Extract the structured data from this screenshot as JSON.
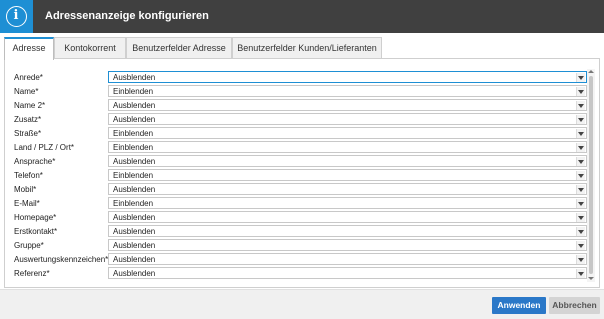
{
  "window": {
    "title": "Adressenanzeige konfigurieren",
    "icon": "info-icon"
  },
  "tabs": [
    {
      "label": "Adresse",
      "active": true
    },
    {
      "label": "Kontokorrent",
      "active": false
    },
    {
      "label": "Benutzerfelder Adresse",
      "active": false
    },
    {
      "label": "Benutzerfelder Kunden/Lieferanten",
      "active": false
    }
  ],
  "fields": [
    {
      "label": "Anrede*",
      "value": "Ausblenden"
    },
    {
      "label": "Name*",
      "value": "Einblenden"
    },
    {
      "label": "Name 2*",
      "value": "Ausblenden"
    },
    {
      "label": "Zusatz*",
      "value": "Ausblenden"
    },
    {
      "label": "Straße*",
      "value": "Einblenden"
    },
    {
      "label": "Land / PLZ / Ort*",
      "value": "Einblenden"
    },
    {
      "label": "Ansprache*",
      "value": "Ausblenden"
    },
    {
      "label": "Telefon*",
      "value": "Einblenden"
    },
    {
      "label": "Mobil*",
      "value": "Ausblenden"
    },
    {
      "label": "E-Mail*",
      "value": "Einblenden"
    },
    {
      "label": "Homepage*",
      "value": "Ausblenden"
    },
    {
      "label": "Erstkontakt*",
      "value": "Ausblenden"
    },
    {
      "label": "Gruppe*",
      "value": "Ausblenden"
    },
    {
      "label": "Auswertungskennzeichen*",
      "value": "Ausblenden"
    },
    {
      "label": "Referenz*",
      "value": "Ausblenden"
    }
  ],
  "footer": {
    "apply_label": "Anwenden",
    "cancel_label": "Abbrechen"
  },
  "colors": {
    "accent": "#1e8fd4",
    "titlebar": "#404040",
    "apply_button": "#2a78c8"
  }
}
